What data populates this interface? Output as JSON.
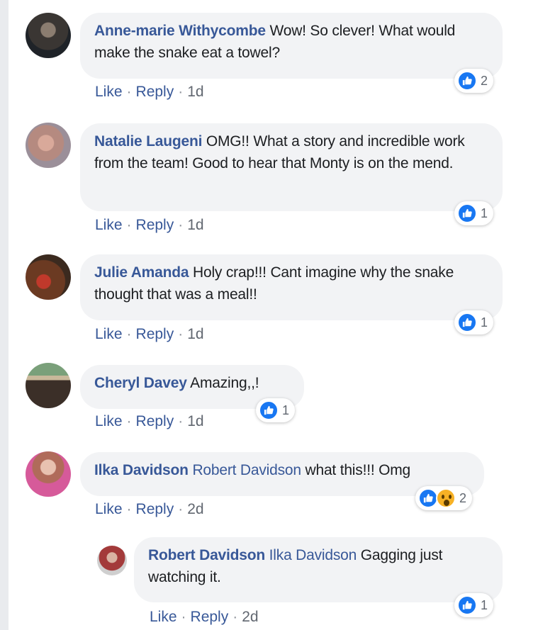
{
  "colors": {
    "name": "#385898",
    "bubble": "#f2f3f5",
    "like": "#1877f2",
    "wow": "#f7b125"
  },
  "actions": {
    "like": "Like",
    "reply": "Reply",
    "sep": "·"
  },
  "comments": [
    {
      "author": "Anne-marie Withycombe",
      "text": "Wow! So clever! What would make the snake eat a towel?",
      "time": "1d",
      "reaction_count": "2",
      "reactions": [
        "like-icon"
      ]
    },
    {
      "author": "Natalie Laugeni",
      "text": "OMG!! What a story and incredible work from the team! Good to hear that Monty is on the mend.",
      "time": "1d",
      "reaction_count": "1",
      "reactions": [
        "like-icon"
      ]
    },
    {
      "author": "Julie Amanda",
      "text": "Holy crap!!! Cant imagine why the snake thought that was a meal!!",
      "time": "1d",
      "reaction_count": "1",
      "reactions": [
        "like-icon"
      ]
    },
    {
      "author": "Cheryl Davey",
      "text": "Amazing,,!",
      "time": "1d",
      "reaction_count": "1",
      "reactions": [
        "like-icon"
      ]
    },
    {
      "author": "Ilka Davidson",
      "tag": "Robert Davidson",
      "text": "what this!!! Omg",
      "time": "2d",
      "reaction_count": "2",
      "reactions": [
        "like-icon",
        "wow-icon"
      ]
    },
    {
      "author": "Robert Davidson",
      "tag": "Ilka Davidson",
      "text": "Gagging just watching it.",
      "time": "2d",
      "reaction_count": "1",
      "reactions": [
        "like-icon"
      ]
    }
  ]
}
